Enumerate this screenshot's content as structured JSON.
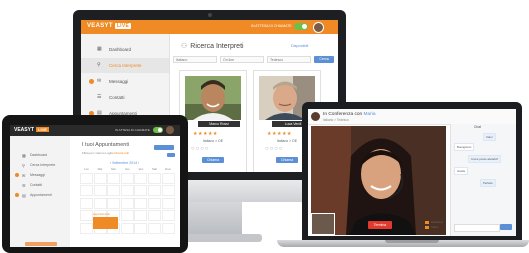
{
  "desktop": {
    "logo": "VEASYT",
    "logo_badge": "LIVE",
    "status": "IN ATTESA DI CHIAMATE",
    "title": "Ricerca Interpreti",
    "title_icon": "people-icon",
    "disponibili": "Disponibili",
    "nav": [
      {
        "label": "Dashboard",
        "icon": "grid-icon",
        "dot": false,
        "active": false
      },
      {
        "label": "Cerca Interprete",
        "icon": "search-icon",
        "dot": false,
        "active": true
      },
      {
        "label": "Messaggi",
        "icon": "envelope-icon",
        "dot": true,
        "active": false
      },
      {
        "label": "Contatti",
        "icon": "contacts-icon",
        "dot": false,
        "active": false
      },
      {
        "label": "Appuntamenti",
        "icon": "calendar-icon",
        "dot": true,
        "active": false
      }
    ],
    "filters": [
      "Italiano",
      "On line",
      "Tedesco"
    ],
    "search_button": "Cerca",
    "cards": [
      {
        "name": "Marco Rossi",
        "stars": "★★★★★",
        "info": "Italiano > DE",
        "button": "Chiama"
      },
      {
        "name": "Luca Verdi",
        "stars": "★★★★★",
        "info": "Italiano > DE",
        "button": "Chiama"
      }
    ]
  },
  "tablet": {
    "logo": "VEASYT",
    "logo_badge": "LIVE",
    "status": "IN ATTESA DI CHIAMATE",
    "title": "I tuoi Appuntamenti",
    "subtitle_prefix": "Filtra per:",
    "subtitle_mid": "Giorno Luglio",
    "subtitle_highlight": "Mostra tutti",
    "month": "Settembre 2014",
    "nav": [
      {
        "label": "Dashboard",
        "icon": "grid-icon",
        "dot": false
      },
      {
        "label": "Cerca Interprete",
        "icon": "search-icon",
        "dot": false
      },
      {
        "label": "Messaggi",
        "icon": "envelope-icon",
        "dot": true
      },
      {
        "label": "Contatti",
        "icon": "contacts-icon",
        "dot": false
      },
      {
        "label": "Appuntamenti",
        "icon": "calendar-icon",
        "dot": true
      }
    ],
    "weekdays": [
      "Lun",
      "Mar",
      "Mer",
      "Gio",
      "Ven",
      "Sab",
      "Dom"
    ],
    "event_label": "Appuntamento"
  },
  "laptop": {
    "conference_prefix": "In Conferenza con",
    "conference_name": "Maria",
    "language": "Italiano > Tedesco",
    "end_button": "Termina",
    "actions": [
      "Disattiva",
      "Video"
    ],
    "chat_title": "Chat",
    "messages": [
      "Ciao!",
      "Buongiorno",
      "Come posso aiutarla?",
      "Grazie",
      "Perfetto"
    ],
    "send_button": "Invia"
  },
  "colors": {
    "accent": "#f08a24",
    "blue": "#5b8fd6",
    "online": "#6cc04a",
    "end_call": "#e23b2e"
  }
}
